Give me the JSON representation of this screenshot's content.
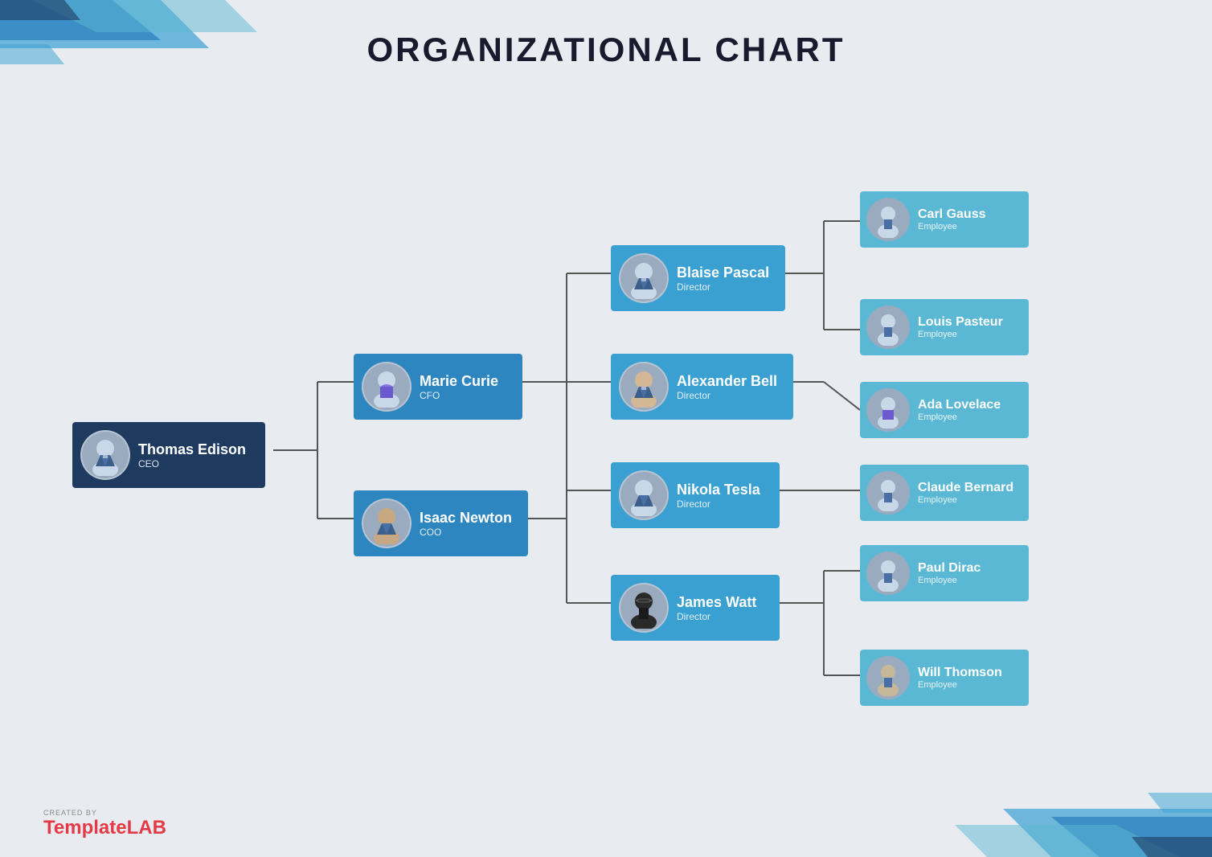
{
  "title": "ORGANIZATIONAL CHART",
  "ceo": {
    "name": "Thomas Edison",
    "role": "CEO",
    "avatar_type": "male_suit"
  },
  "managers": [
    {
      "name": "Marie Curie",
      "role": "CFO",
      "avatar_type": "female"
    },
    {
      "name": "Isaac Newton",
      "role": "COO",
      "avatar_type": "male_casual"
    }
  ],
  "directors": [
    {
      "name": "Blaise Pascal",
      "role": "Director",
      "avatar_type": "male_suit"
    },
    {
      "name": "Alexander Bell",
      "role": "Director",
      "avatar_type": "male_suit2"
    },
    {
      "name": "Nikola Tesla",
      "role": "Director",
      "avatar_type": "male_suit"
    },
    {
      "name": "James Watt",
      "role": "Director",
      "avatar_type": "male_glasses"
    }
  ],
  "employees": [
    {
      "name": "Carl Gauss",
      "role": "Employee",
      "avatar_type": "male_suit"
    },
    {
      "name": "Louis Pasteur",
      "role": "Employee",
      "avatar_type": "male_suit"
    },
    {
      "name": "Ada Lovelace",
      "role": "Employee",
      "avatar_type": "female2"
    },
    {
      "name": "Claude Bernard",
      "role": "Employee",
      "avatar_type": "male_suit"
    },
    {
      "name": "Paul Dirac",
      "role": "Employee",
      "avatar_type": "male_suit"
    },
    {
      "name": "Will Thomson",
      "role": "Employee",
      "avatar_type": "male_suit"
    }
  ],
  "footer": {
    "created_by": "CREATED BY",
    "brand_part1": "Template",
    "brand_part2": "LAB"
  },
  "colors": {
    "background": "#e8ecf0",
    "ceo_box": "#1e3a5f",
    "manager_box": "#2e86c1",
    "director_box": "#3a9fd1",
    "employee_box": "#5bb8d4",
    "connector": "#555"
  }
}
